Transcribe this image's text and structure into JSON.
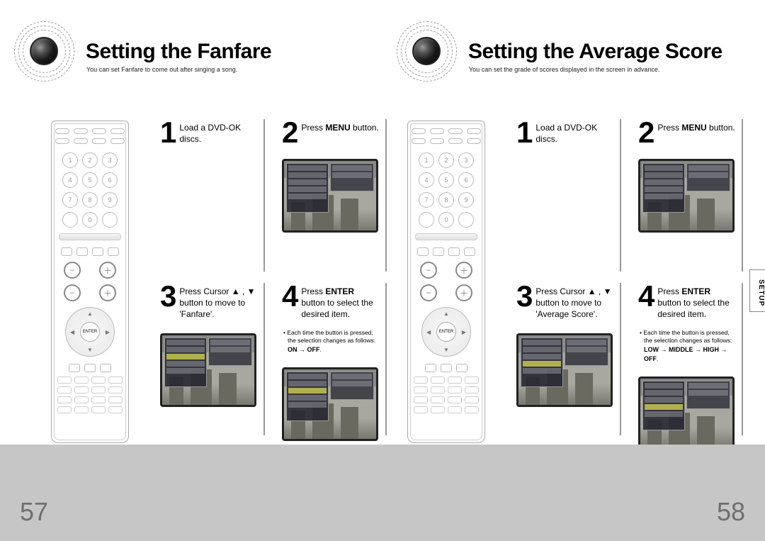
{
  "left": {
    "title": "Setting the Fanfare",
    "subtitle": "You can set Fanfare to come out after singing a song.",
    "pageNumber": "57",
    "steps": {
      "s1": {
        "num": "1",
        "text": "Load a DVD-OK discs."
      },
      "s2": {
        "num": "2",
        "pre": "Press ",
        "bold": "MENU",
        "post": " button."
      },
      "s3": {
        "num": "3",
        "text": "Press Cursor ▲ , ▼ button to move to 'Fanfare'."
      },
      "s4": {
        "num": "4",
        "pre": "Press ",
        "bold": "ENTER",
        "post": " button to select the desired item."
      }
    },
    "note_line1": "• Each time the button is pressed, the selection changes as follows:",
    "note_seq": "ON → OFF"
  },
  "right": {
    "title": "Setting the Average Score",
    "subtitle": "You can set the grade of scores displayed in the screen in advance.",
    "pageNumber": "58",
    "steps": {
      "s1": {
        "num": "1",
        "text": "Load a DVD-OK discs."
      },
      "s2": {
        "num": "2",
        "pre": "Press ",
        "bold": "MENU",
        "post": " button."
      },
      "s3": {
        "num": "3",
        "text": "Press Cursor ▲ , ▼ button to move to 'Average Score'."
      },
      "s4": {
        "num": "4",
        "pre": "Press ",
        "bold": "ENTER",
        "post": " button to select the desired item."
      }
    },
    "note_line1": "• Each time the button is pressed, the selection changes as follows:",
    "note_seq": "LOW → MIDDLE → HIGH → OFF"
  },
  "tab": "SETUP",
  "remote": {
    "nums": [
      "1",
      "2",
      "3",
      "4",
      "5",
      "6",
      "7",
      "8",
      "9",
      "",
      "0",
      ""
    ],
    "enter": "ENTER"
  }
}
